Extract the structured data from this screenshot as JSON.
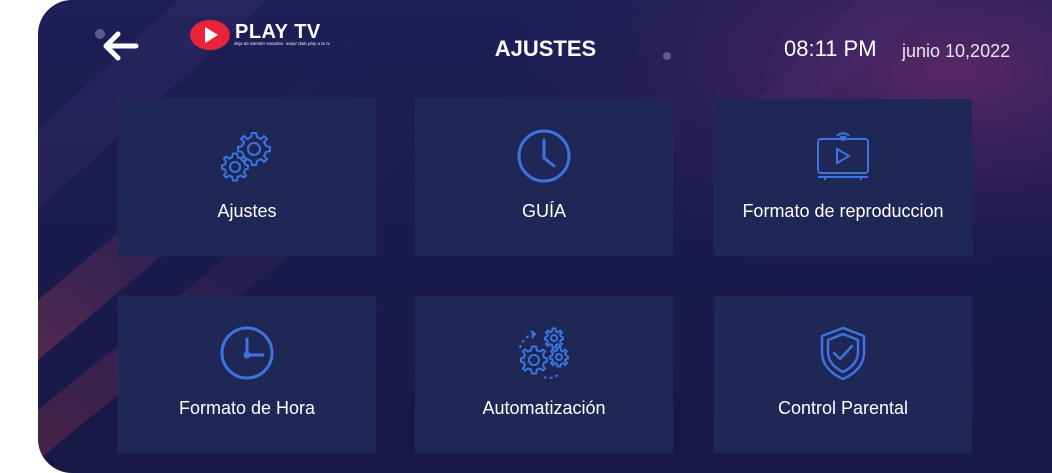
{
  "header": {
    "back_icon": "arrow-left-icon",
    "logo": {
      "title": "PLAY TV",
      "tagline": "deja de atender estudios. mejor dale play a tu tv"
    },
    "page_title": "AJUSTES",
    "time": "08:11 PM",
    "date": "junio 10,2022"
  },
  "tiles": [
    {
      "label": "Ajustes",
      "icon": "gears-icon"
    },
    {
      "label": "GUÍA",
      "icon": "clock-icon"
    },
    {
      "label": "Formato de reproduccion",
      "icon": "tv-play-icon"
    },
    {
      "label": "Formato de Hora",
      "icon": "clock-icon"
    },
    {
      "label": "Automatización",
      "icon": "automation-gears-icon"
    },
    {
      "label": "Control Parental",
      "icon": "shield-check-icon"
    }
  ],
  "colors": {
    "background": "#1b1b4f",
    "tile": "#1f2756",
    "icon_blue": "#3b74e0",
    "logo_red": "#e8233a"
  }
}
